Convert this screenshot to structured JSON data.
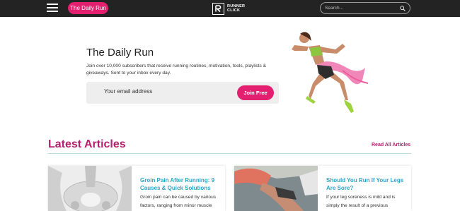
{
  "header": {
    "menu_icon": "hamburger-menu-icon",
    "daily_run_label": "The Daily Run",
    "logo_line1": "RUNNER",
    "logo_line2": "CLICK",
    "search_placeholder": "Search...",
    "search_icon": "search-icon"
  },
  "hero": {
    "title": "The Daily Run",
    "description": "Join over 10,000 subscribers that receive running routines, motivation, tools, playlists & giveaways. Sent to your inbox every day.",
    "email_placeholder": "Your email address",
    "join_label": "Join Free",
    "illustration": "runner-woman-illustration"
  },
  "latest": {
    "title": "Latest Articles",
    "read_all_label": "Read All Articles",
    "articles": [
      {
        "title": "Groin Pain After Running: 9 Causes & Quick Solutions",
        "excerpt": "Groin pain can be caused by various factors, ranging from minor muscle",
        "image": "pelvis-xray-image"
      },
      {
        "title": "Should You Run If Your Legs Are Sore?",
        "excerpt": "If your leg soreness is mild and is simply the result of a previous",
        "image": "runner-stretching-leg-image"
      }
    ]
  },
  "colors": {
    "topbar": "#232323",
    "accent_pink": "#e3206f",
    "heading_magenta": "#b41f6e",
    "link_blue": "#2aa5c7"
  }
}
